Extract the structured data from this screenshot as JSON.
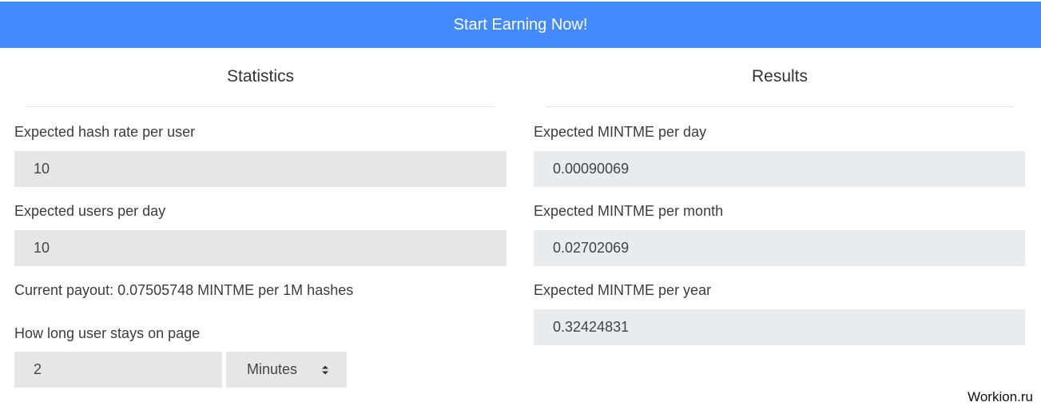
{
  "banner": {
    "label": "Start Earning Now!"
  },
  "statistics": {
    "title": "Statistics",
    "hash_rate": {
      "label": "Expected hash rate per user",
      "value": "10"
    },
    "users": {
      "label": "Expected users per day",
      "value": "10"
    },
    "payout_text": "Current payout: 0.07505748 MINTME per 1M hashes",
    "stay": {
      "label": "How long user stays on page",
      "value": "2",
      "unit_selected": "Minutes"
    }
  },
  "results": {
    "title": "Results",
    "per_day": {
      "label": "Expected MINTME per day",
      "value": "0.00090069"
    },
    "per_month": {
      "label": "Expected MINTME per month",
      "value": "0.02702069"
    },
    "per_year": {
      "label": "Expected MINTME per year",
      "value": "0.32424831"
    }
  },
  "watermark": "Workion.ru",
  "colors": {
    "banner": "#448aff",
    "input_bg": "#e6e6e6",
    "readonly_bg": "#e9ecef"
  }
}
